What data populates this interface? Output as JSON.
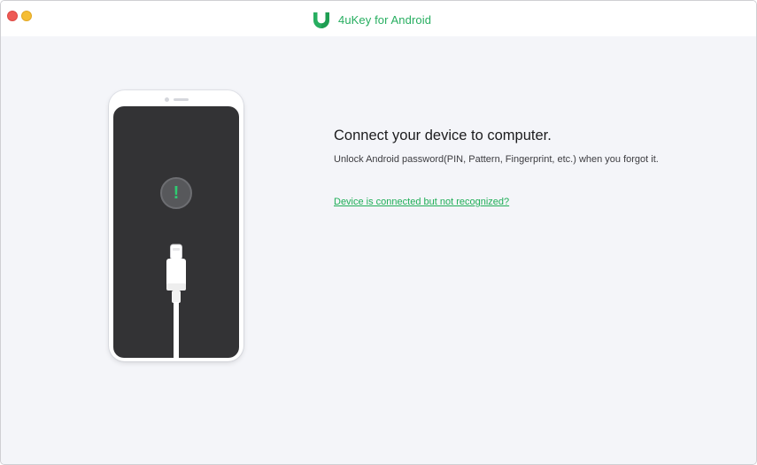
{
  "window": {
    "title": "4uKey for Android",
    "logo_icon": "shield-leaf-icon",
    "accent_color": "#27ae60",
    "traffic_lights": [
      "close",
      "minimize"
    ]
  },
  "main": {
    "heading": "Connect your device to computer.",
    "description": "Unlock Android password(PIN, Pattern, Fingerprint, etc.) when you forgot it.",
    "help_link": "Device is connected but not recognized?"
  },
  "illustration": {
    "phone_icon": "phone-icon",
    "status_icon": "exclamation-icon",
    "status_glyph": "!",
    "cable_icon": "usb-c-cable-icon"
  }
}
